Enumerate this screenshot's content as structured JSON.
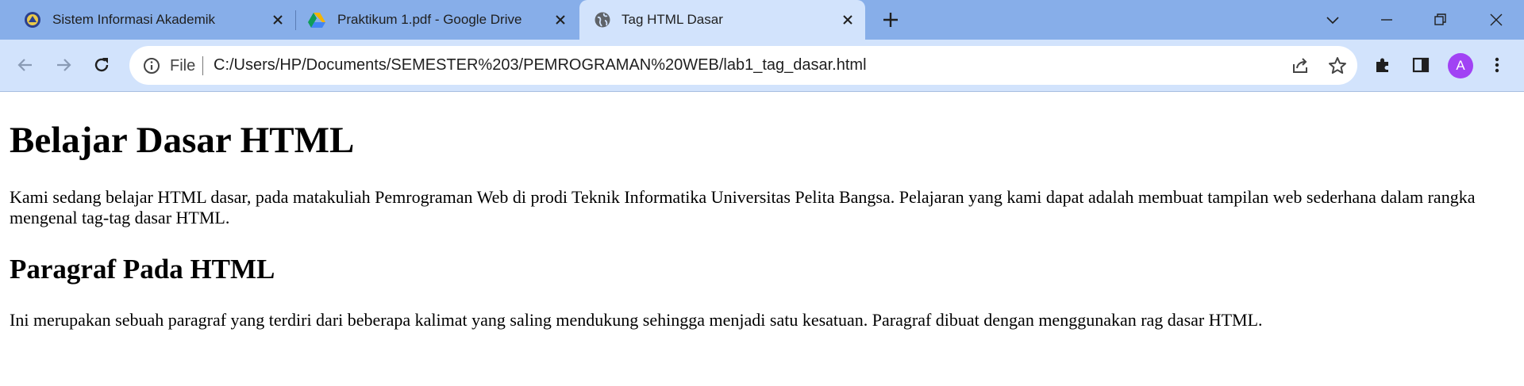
{
  "tabs": [
    {
      "title": "Sistem Informasi Akademik",
      "active": false
    },
    {
      "title": "Praktikum 1.pdf - Google Drive",
      "active": false
    },
    {
      "title": "Tag HTML Dasar",
      "active": true
    }
  ],
  "omnibox": {
    "scheme": "File",
    "url": "C:/Users/HP/Documents/SEMESTER%203/PEMROGRAMAN%20WEB/lab1_tag_dasar.html"
  },
  "profile": {
    "initial": "A",
    "color": "#a142f4"
  },
  "content": {
    "heading1": "Belajar Dasar HTML",
    "paragraph1": "Kami sedang belajar HTML dasar, pada matakuliah Pemrograman Web di prodi Teknik Informatika Universitas Pelita Bangsa. Pelajaran yang kami dapat adalah membuat tampilan web sederhana dalam rangka mengenal tag-tag dasar HTML.",
    "heading2": "Paragraf Pada HTML",
    "paragraph2": "Ini merupakan sebuah paragraf yang terdiri dari beberapa kalimat yang saling mendukung sehingga menjadi satu kesatuan. Paragraf dibuat dengan menggunakan rag dasar HTML."
  },
  "colors": {
    "tabstrip": "#87aee9",
    "toolbar": "#d2e3fc",
    "active_tab": "#d2e3fc"
  },
  "icons": [
    "university-logo-icon",
    "google-drive-icon",
    "globe-icon",
    "close-icon",
    "plus-icon",
    "chevron-down-icon",
    "minimize-icon",
    "restore-icon",
    "window-close-icon",
    "back-arrow-icon",
    "forward-arrow-icon",
    "reload-icon",
    "info-icon",
    "share-icon",
    "star-icon",
    "extensions-icon",
    "side-panel-icon",
    "kebab-menu-icon"
  ]
}
